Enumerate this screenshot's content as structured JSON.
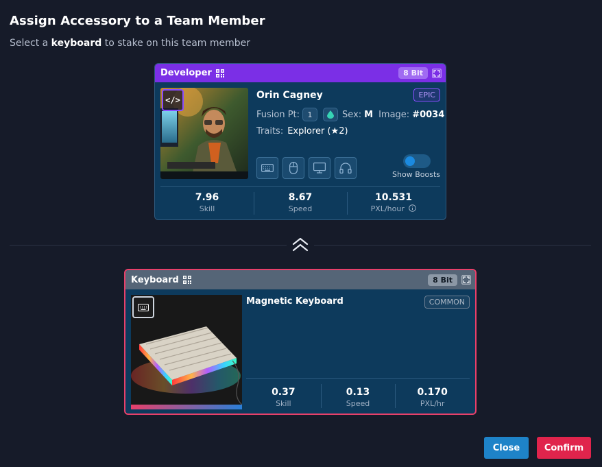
{
  "header": {
    "title": "Assign Accessory to a Team Member",
    "subtitle_prefix": "Select a",
    "subtitle_bold": "keyboard",
    "subtitle_suffix": "to stake on this team member"
  },
  "developer_card": {
    "category": "Developer",
    "bit": "8 Bit",
    "name": "Orin Cagney",
    "rarity": "EPIC",
    "fusion_label": "Fusion Pt:",
    "fusion_value": "1",
    "sex_label": "Sex:",
    "sex_value": "M",
    "image_label": "Image:",
    "image_value": "#0034",
    "traits_label": "Traits:",
    "traits_value": "Explorer (★2)",
    "slots": [
      "keyboard-icon",
      "mouse-icon",
      "monitor-icon",
      "headphones-icon"
    ],
    "toggle_label": "Show Boosts",
    "stats": [
      {
        "value": "7.96",
        "label": "Skill"
      },
      {
        "value": "8.67",
        "label": "Speed"
      },
      {
        "value": "10.531",
        "label": "PXL/hour"
      }
    ]
  },
  "keyboard_card": {
    "category": "Keyboard",
    "bit": "8 Bit",
    "name": "Magnetic Keyboard",
    "rarity": "COMMON",
    "stats": [
      {
        "value": "0.37",
        "label": "Skill"
      },
      {
        "value": "0.13",
        "label": "Speed"
      },
      {
        "value": "0.170",
        "label": "PXL/hr"
      }
    ]
  },
  "buttons": {
    "close": "Close",
    "confirm": "Confirm"
  },
  "colors": {
    "background": "#161b29",
    "card": "#0d3a5c",
    "developer_header": "#7b2fe6",
    "keyboard_border": "#e8406a",
    "close_button": "#1e83c8",
    "confirm_button": "#e0244c"
  }
}
